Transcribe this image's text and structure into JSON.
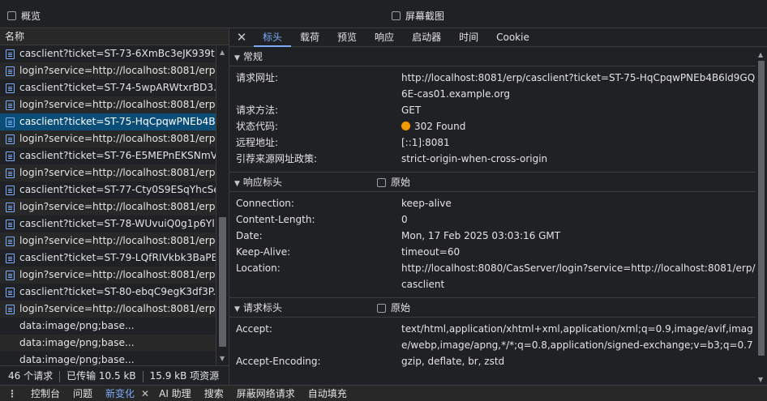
{
  "topbar": {
    "overview_label": "概览",
    "screenshot_label": "屏幕截图"
  },
  "list": {
    "header": "名称",
    "items": [
      "casclient?ticket=ST-73-6XmBc3eJK939t...",
      "login?service=http://localhost:8081/erp...",
      "casclient?ticket=ST-74-5wpARWtxrBD3...",
      "login?service=http://localhost:8081/erp...",
      "casclient?ticket=ST-75-HqCpqwPNEb4B...",
      "login?service=http://localhost:8081/erp...",
      "casclient?ticket=ST-76-E5MEPnEKSNmV...",
      "login?service=http://localhost:8081/erp...",
      "casclient?ticket=ST-77-Cty0S9ESqYhcSe...",
      "login?service=http://localhost:8081/erp...",
      "casclient?ticket=ST-78-WUvuiQ0g1p6Yl...",
      "login?service=http://localhost:8081/erp...",
      "casclient?ticket=ST-79-LQfRIVkbk3BaPE...",
      "login?service=http://localhost:8081/erp...",
      "casclient?ticket=ST-80-ebqC9egK3df3P...",
      "login?service=http://localhost:8081/erp...",
      "data:image/png;base...",
      "data:image/png;base...",
      "data:image/png;base..."
    ],
    "selected_index": 4
  },
  "status": {
    "requests": "46 个请求",
    "transferred": "已传输 10.5 kB",
    "resources": "15.9 kB 项资源"
  },
  "tabs": [
    "标头",
    "载荷",
    "预览",
    "响应",
    "启动器",
    "时间",
    "Cookie"
  ],
  "general": {
    "title": "常规",
    "rows": [
      {
        "k": "请求网址:",
        "v": "http://localhost:8081/erp/casclient?ticket=ST-75-HqCpqwPNEb4B6ld9GQ6E-cas01.example.org"
      },
      {
        "k": "请求方法:",
        "v": "GET"
      },
      {
        "k": "状态代码:",
        "v": "302 Found"
      },
      {
        "k": "远程地址:",
        "v": "[::1]:8081"
      },
      {
        "k": "引荐来源网址政策:",
        "v": "strict-origin-when-cross-origin"
      }
    ]
  },
  "response_headers": {
    "title": "响应标头",
    "raw_label": "原始",
    "rows": [
      {
        "k": "Connection:",
        "v": "keep-alive"
      },
      {
        "k": "Content-Length:",
        "v": "0"
      },
      {
        "k": "Date:",
        "v": "Mon, 17 Feb 2025 03:03:16 GMT"
      },
      {
        "k": "Keep-Alive:",
        "v": "timeout=60"
      },
      {
        "k": "Location:",
        "v": "http://localhost:8080/CasServer/login?service=http://localhost:8081/erp/casclient"
      }
    ]
  },
  "request_headers": {
    "title": "请求标头",
    "raw_label": "原始",
    "rows": [
      {
        "k": "Accept:",
        "v": "text/html,application/xhtml+xml,application/xml;q=0.9,image/avif,image/webp,image/apng,*/*;q=0.8,application/signed-exchange;v=b3;q=0.7"
      },
      {
        "k": "Accept-Encoding:",
        "v": "gzip, deflate, br, zstd"
      }
    ]
  },
  "drawer": {
    "items": [
      "控制台",
      "问题",
      "新变化",
      "AI 助理",
      "搜索",
      "屏蔽网络请求",
      "自动填充"
    ],
    "active_index": 2
  },
  "colors": {
    "accent": "#7cacf8",
    "selected_row": "#0b4f79",
    "status_dot": "#f29900"
  }
}
